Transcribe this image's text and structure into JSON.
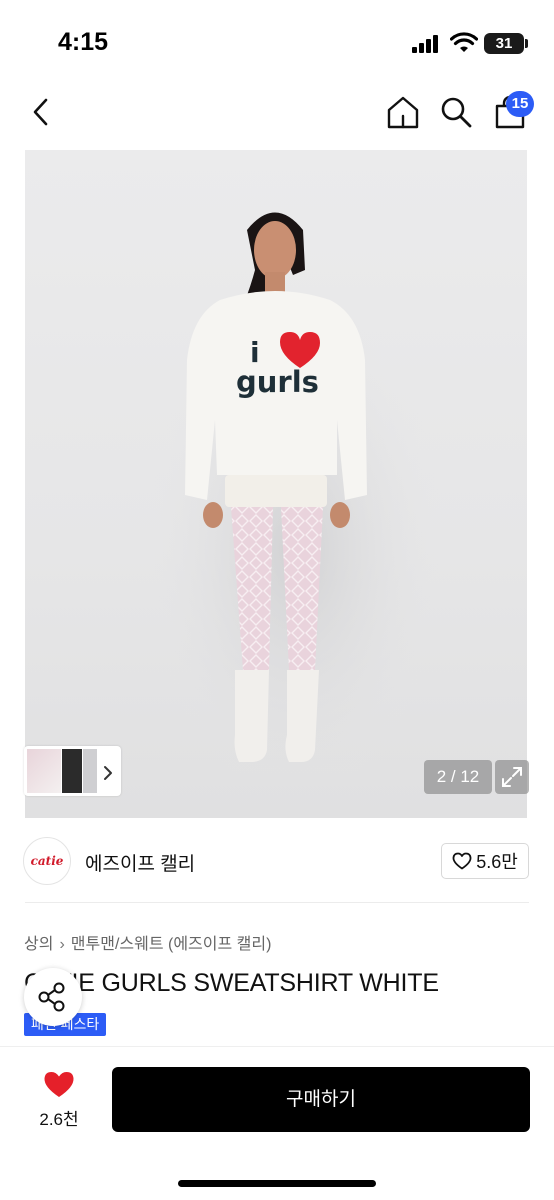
{
  "status_bar": {
    "time": "4:15",
    "battery": "31"
  },
  "header": {
    "cart_count": "15"
  },
  "gallery": {
    "counter": "2 / 12",
    "print_line1": "i",
    "print_line2": "gurls"
  },
  "brand": {
    "logo_text": "catie",
    "name": "에즈이프 캘리",
    "likes": "5.6만"
  },
  "breadcrumb": {
    "category": "상의",
    "subcategory": "맨투맨/스웨트 (에즈이프 캘리)"
  },
  "product": {
    "title": "CATIE GURLS SWEATSHIRT WHITE",
    "event_badge": "패션 페스타"
  },
  "bottom_bar": {
    "wish_count": "2.6천",
    "buy_label": "구매하기"
  },
  "colors": {
    "accent_blue": "#2c5cf6",
    "heart_red": "#e5202a",
    "buy_black": "#000000"
  }
}
